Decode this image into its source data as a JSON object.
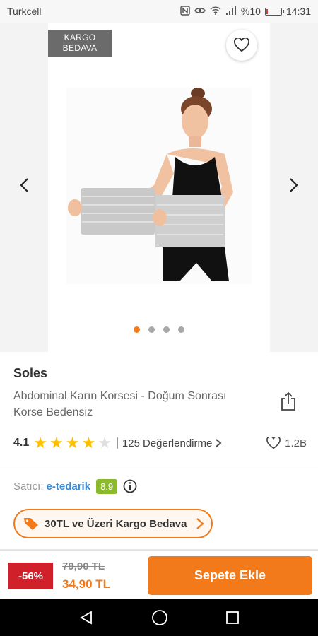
{
  "status": {
    "carrier": "Turkcell",
    "battery": "%10",
    "time": "14:31",
    "battery_level": 0.1
  },
  "gallery": {
    "badge_line1": "KARGO",
    "badge_line2": "BEDAVA",
    "image_count": 4,
    "active_index": 0
  },
  "product": {
    "brand": "Soles",
    "title": "Abdominal Karın Korsesi - Doğum Sonrası Korse Bedensiz",
    "rating": "4.1",
    "rating_value": 4.1,
    "review_count": "125",
    "review_label": "Değerlendirme",
    "likes": "1.2B"
  },
  "seller": {
    "label": "Satıcı:",
    "name": "e-tedarik",
    "score": "8.9"
  },
  "promo": {
    "text": "30TL ve Üzeri Kargo Bedava"
  },
  "cart": {
    "discount": "-56%",
    "old_price": "79,90 TL",
    "new_price": "34,90 TL",
    "add_label": "Sepete Ekle"
  },
  "colors": {
    "accent": "#f27a1a",
    "discount": "#d0202a",
    "seller_score": "#8bbb2c",
    "link": "#3a8ad6"
  },
  "icons": [
    "heart-icon",
    "chevron-left-icon",
    "chevron-right-icon",
    "share-icon",
    "star-icon",
    "info-icon",
    "tag-icon",
    "back-icon",
    "home-icon",
    "recents-icon"
  ]
}
